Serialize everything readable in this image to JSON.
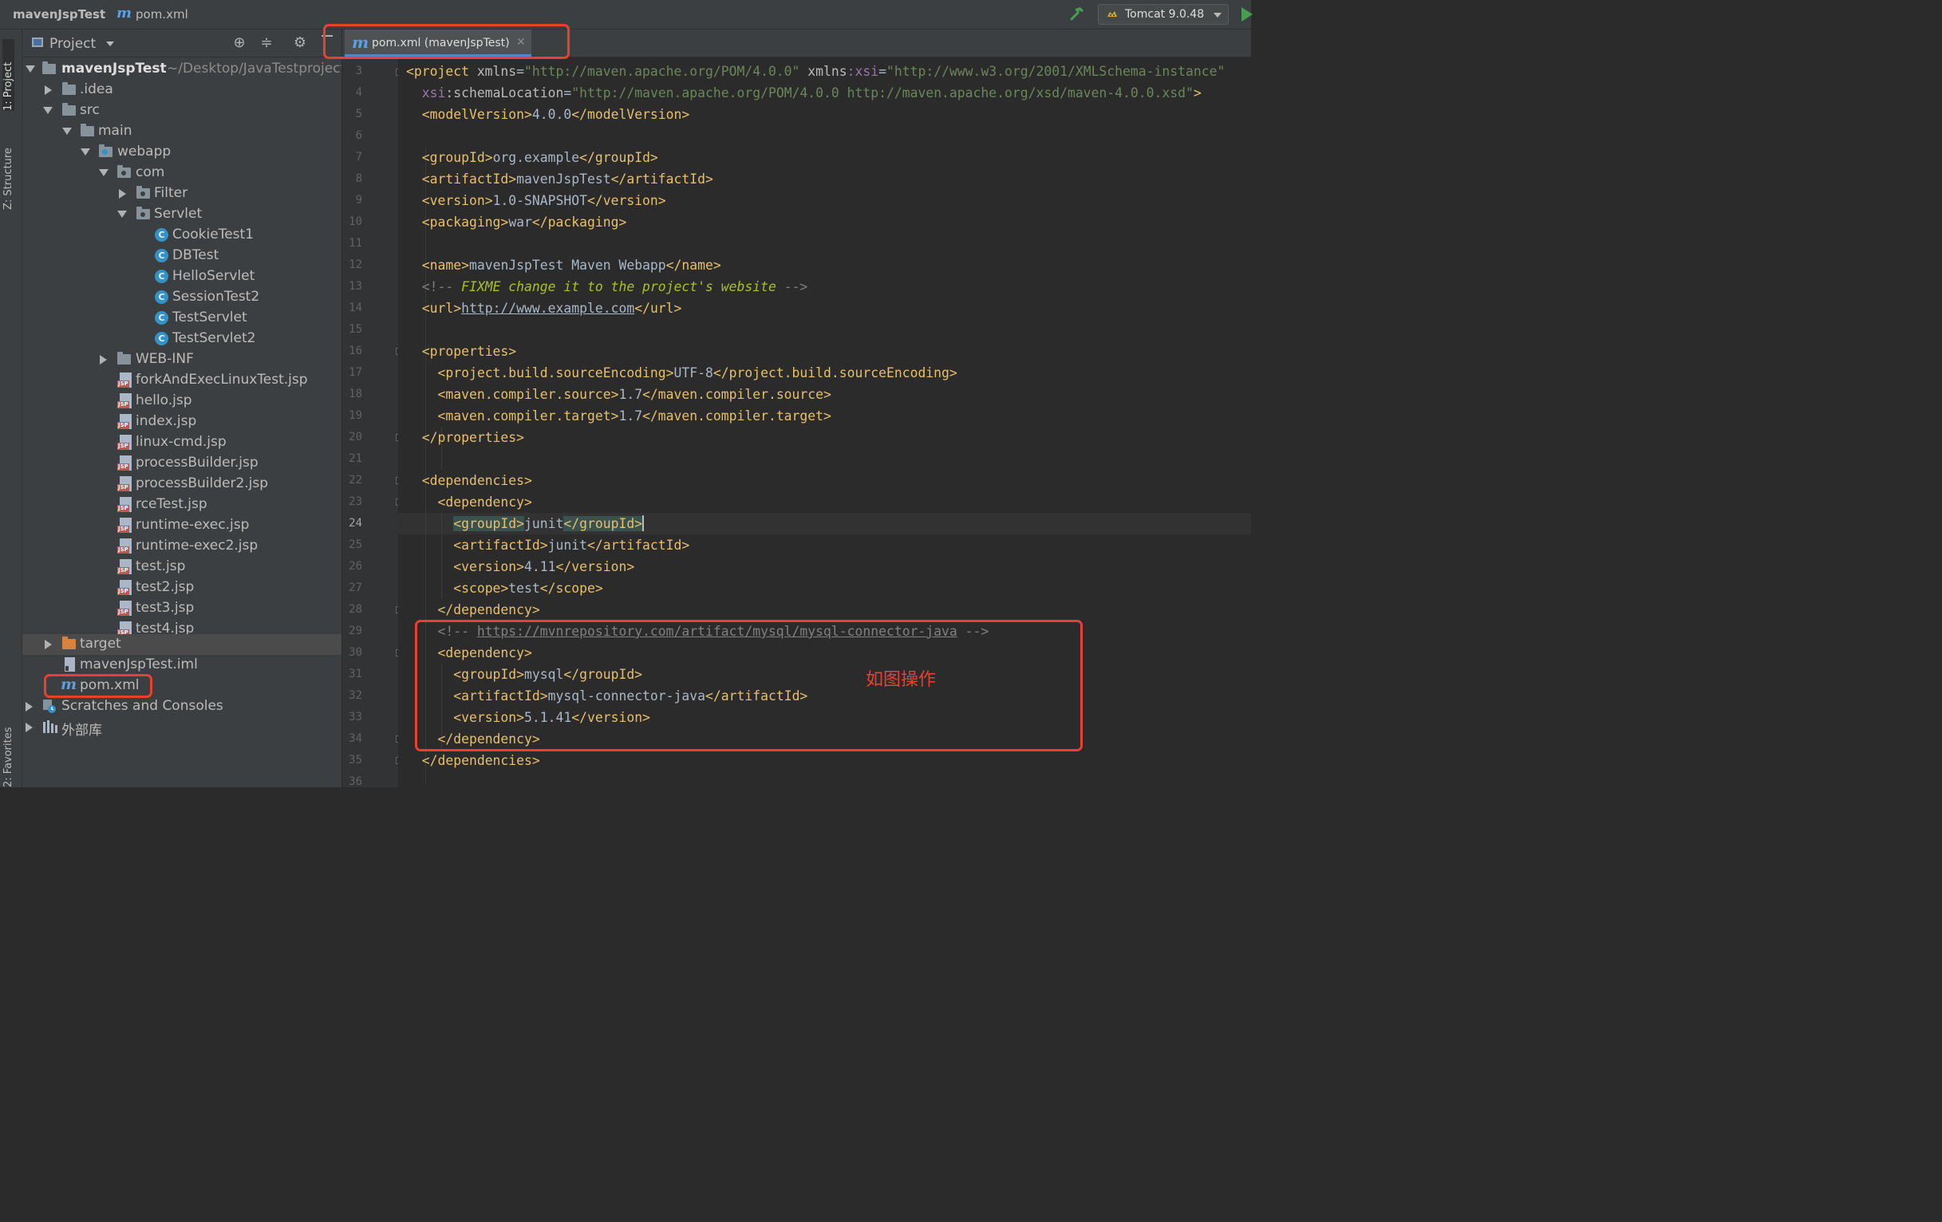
{
  "titlebar": {
    "project": "mavenJspTest",
    "file": "pom.xml",
    "run_config": "Tomcat 9.0.48"
  },
  "sidestrip": {
    "project_tab": "1: Project",
    "structure_tab": "Z: Structure",
    "favorites_tab": "2: Favorites"
  },
  "project_panel": {
    "title": "Project",
    "tree": [
      {
        "label": "mavenJspTest",
        "path": "~/Desktop/JavaTestproject"
      },
      {
        "label": ".idea"
      },
      {
        "label": "src"
      },
      {
        "label": "main"
      },
      {
        "label": "webapp"
      },
      {
        "label": "com"
      },
      {
        "label": "Filter"
      },
      {
        "label": "Servlet"
      },
      {
        "label": "CookieTest1"
      },
      {
        "label": "DBTest"
      },
      {
        "label": "HelloServlet"
      },
      {
        "label": "SessionTest2"
      },
      {
        "label": "TestServlet"
      },
      {
        "label": "TestServlet2"
      },
      {
        "label": "WEB-INF"
      },
      {
        "label": "forkAndExecLinuxTest.jsp"
      },
      {
        "label": "hello.jsp"
      },
      {
        "label": "index.jsp"
      },
      {
        "label": "linux-cmd.jsp"
      },
      {
        "label": "processBuilder.jsp"
      },
      {
        "label": "processBuilder2.jsp"
      },
      {
        "label": "rceTest.jsp"
      },
      {
        "label": "runtime-exec.jsp"
      },
      {
        "label": "runtime-exec2.jsp"
      },
      {
        "label": "test.jsp"
      },
      {
        "label": "test2.jsp"
      },
      {
        "label": "test3.jsp"
      },
      {
        "label": "test4.jsp"
      },
      {
        "label": "target"
      },
      {
        "label": "mavenJspTest.iml"
      },
      {
        "label": "pom.xml"
      },
      {
        "label": "Scratches and Consoles"
      },
      {
        "label": "外部库"
      }
    ]
  },
  "editor": {
    "tab_label": "pom.xml (mavenJspTest)",
    "current_line": "24",
    "line_numbers": [
      "3",
      "4",
      "5",
      "6",
      "7",
      "8",
      "9",
      "10",
      "11",
      "12",
      "13",
      "14",
      "15",
      "16",
      "17",
      "18",
      "19",
      "20",
      "21",
      "22",
      "23",
      "24",
      "25",
      "26",
      "27",
      "28",
      "29",
      "30",
      "31",
      "32",
      "33",
      "34",
      "35",
      "36"
    ],
    "code": {
      "l3": {
        "t1": "<project ",
        "a1": "xmlns",
        "e1": "=",
        "v1": "\"http://maven.apache.org/POM/4.0.0\"",
        "a2": " xmlns",
        "n1": ":xsi",
        "e2": "=",
        "v2": "\"http://www.w3.org/2001/XMLSchema-instance\""
      },
      "l4": {
        "n1": "xsi",
        "a1": ":schemaLocation",
        "e1": "=",
        "v1": "\"http://maven.apache.org/POM/4.0.0 http://maven.apache.org/xsd/maven-4.0.0.xsd\"",
        "t1": ">"
      },
      "l5": {
        "t1": "<modelVersion>",
        "x": "4.0.0",
        "t2": "</modelVersion>"
      },
      "l7": {
        "t1": "<groupId>",
        "x": "org.example",
        "t2": "</groupId>"
      },
      "l8": {
        "t1": "<artifactId>",
        "x": "mavenJspTest",
        "t2": "</artifactId>"
      },
      "l9": {
        "t1": "<version>",
        "x": "1.0-SNAPSHOT",
        "t2": "</version>"
      },
      "l10": {
        "t1": "<packaging>",
        "x": "war",
        "t2": "</packaging>"
      },
      "l12": {
        "t1": "<name>",
        "x": "mavenJspTest Maven Webapp",
        "t2": "</name>"
      },
      "l13": {
        "c1": "<!-- ",
        "todo": "FIXME change it to the project's website",
        "c2": " -->"
      },
      "l14": {
        "t1": "<url>",
        "x": "http://www.example.com",
        "t2": "</url>"
      },
      "l16": {
        "t1": "<properties>"
      },
      "l17": {
        "t1": "<project.build.sourceEncoding>",
        "x": "UTF-8",
        "t2": "</project.build.sourceEncoding>"
      },
      "l18": {
        "t1": "<maven.compiler.source>",
        "x": "1.7",
        "t2": "</maven.compiler.source>"
      },
      "l19": {
        "t1": "<maven.compiler.target>",
        "x": "1.7",
        "t2": "</maven.compiler.target>"
      },
      "l20": {
        "t1": "</properties>"
      },
      "l22": {
        "t1": "<dependencies>"
      },
      "l23": {
        "t1": "<dependency>"
      },
      "l24": {
        "t1": "<groupId>",
        "x": "junit",
        "t2": "</groupId>"
      },
      "l25": {
        "t1": "<artifactId>",
        "x": "junit",
        "t2": "</artifactId>"
      },
      "l26": {
        "t1": "<version>",
        "x": "4.11",
        "t2": "</version>"
      },
      "l27": {
        "t1": "<scope>",
        "x": "test",
        "t2": "</scope>"
      },
      "l28": {
        "t1": "</dependency>"
      },
      "l29": {
        "c1": "<!-- ",
        "url": "https://mvnrepository.com/artifact/mysql/mysql-connector-java",
        "c2": " -->"
      },
      "l30": {
        "t1": "<dependency>"
      },
      "l31": {
        "t1": "<groupId>",
        "x": "mysql",
        "t2": "</groupId>"
      },
      "l32": {
        "t1": "<artifactId>",
        "x": "mysql-connector-java",
        "t2": "</artifactId>"
      },
      "l33": {
        "t1": "<version>",
        "x": "5.1.41",
        "t2": "</version>"
      },
      "l34": {
        "t1": "</dependency>"
      },
      "l35": {
        "t1": "</dependencies>"
      }
    }
  },
  "annotation": {
    "note": "如图操作",
    "color": "#e9412e"
  },
  "colors": {
    "tag": "#e8bf6a",
    "string": "#6a8759",
    "comment": "#808080",
    "todo": "#a8c023",
    "namespace": "#9876aa",
    "accent": "#4a88c7"
  },
  "icons": {
    "build": "hammer-icon",
    "run": "play-icon",
    "locate": "crosshair-icon",
    "collapse": "collapse-all-icon",
    "settings": "gear-icon",
    "hide": "minus-icon",
    "maven_file": "maven-m-icon",
    "java_class": "class-c-icon",
    "jsp_file": "jsp-file-icon"
  }
}
